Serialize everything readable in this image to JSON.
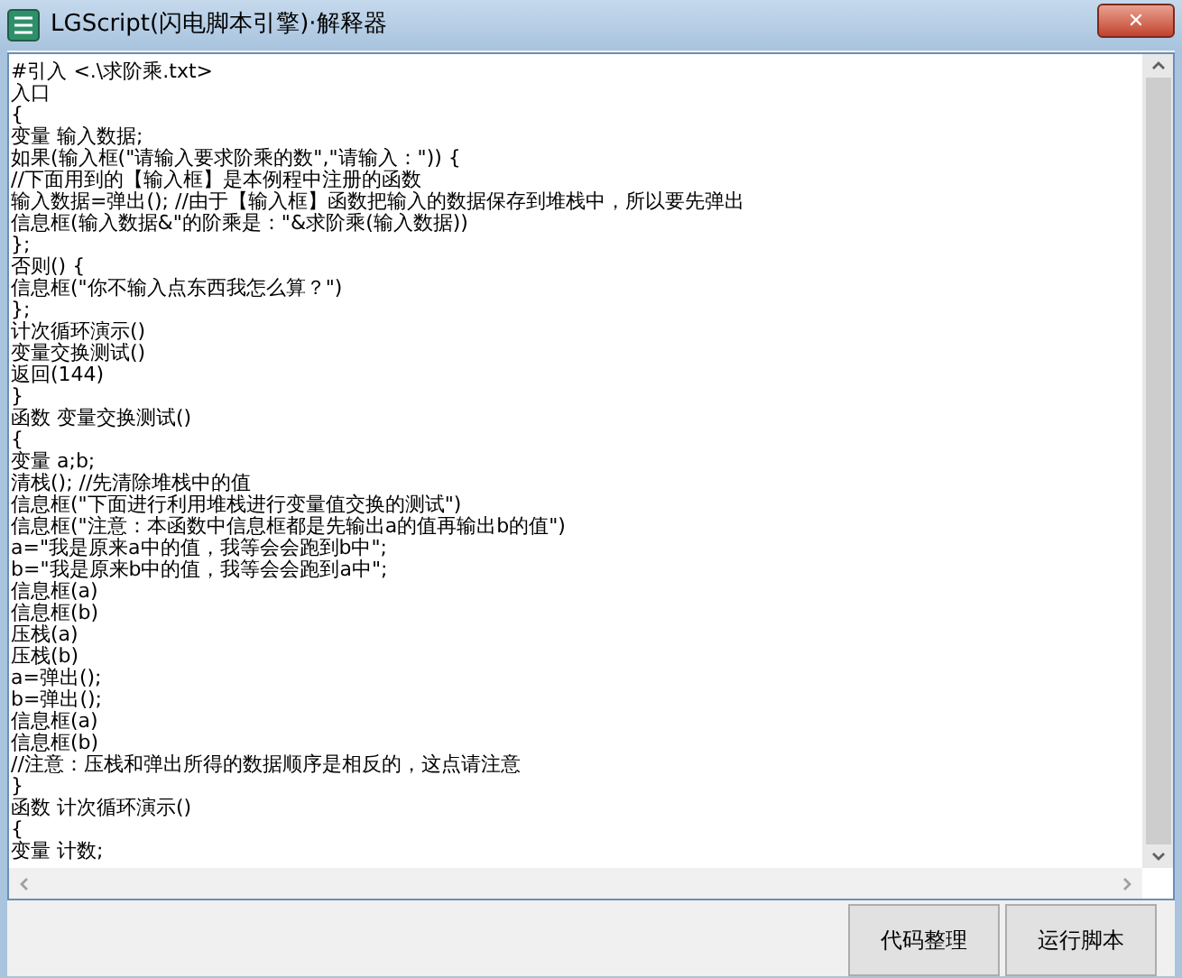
{
  "window": {
    "title": "LGScript(闪电脚本引擎)·解释器",
    "close_glyph": "✕"
  },
  "editor": {
    "lines": [
      "#引入 <.\\求阶乘.txt>",
      "入口",
      "{",
      "变量 输入数据;",
      "如果(输入框(\"请输入要求阶乘的数\",\"请输入：\")) {",
      "//下面用到的【输入框】是本例程中注册的函数",
      "输入数据=弹出(); //由于【输入框】函数把输入的数据保存到堆栈中，所以要先弹出",
      "信息框(输入数据&\"的阶乘是：\"&求阶乘(输入数据))",
      "};",
      "否则() {",
      "信息框(\"你不输入点东西我怎么算？\")",
      "};",
      "计次循环演示()",
      "变量交换测试()",
      "返回(144)",
      "}",
      "函数 变量交换测试()",
      "{",
      "变量 a;b;",
      "清栈(); //先清除堆栈中的值",
      "信息框(\"下面进行利用堆栈进行变量值交换的测试\")",
      "信息框(\"注意：本函数中信息框都是先输出a的值再输出b的值\")",
      "a=\"我是原来a中的值，我等会会跑到b中\";",
      "b=\"我是原来b中的值，我等会会跑到a中\";",
      "信息框(a)",
      "信息框(b)",
      "压栈(a)",
      "压栈(b)",
      "a=弹出();",
      "b=弹出();",
      "信息框(a)",
      "信息框(b)",
      "//注意：压栈和弹出所得的数据顺序是相反的，这点请注意",
      "}",
      "函数 计次循环演示()",
      "{",
      "变量 计数;"
    ]
  },
  "buttons": [
    "代码整理",
    "运行脚本"
  ]
}
